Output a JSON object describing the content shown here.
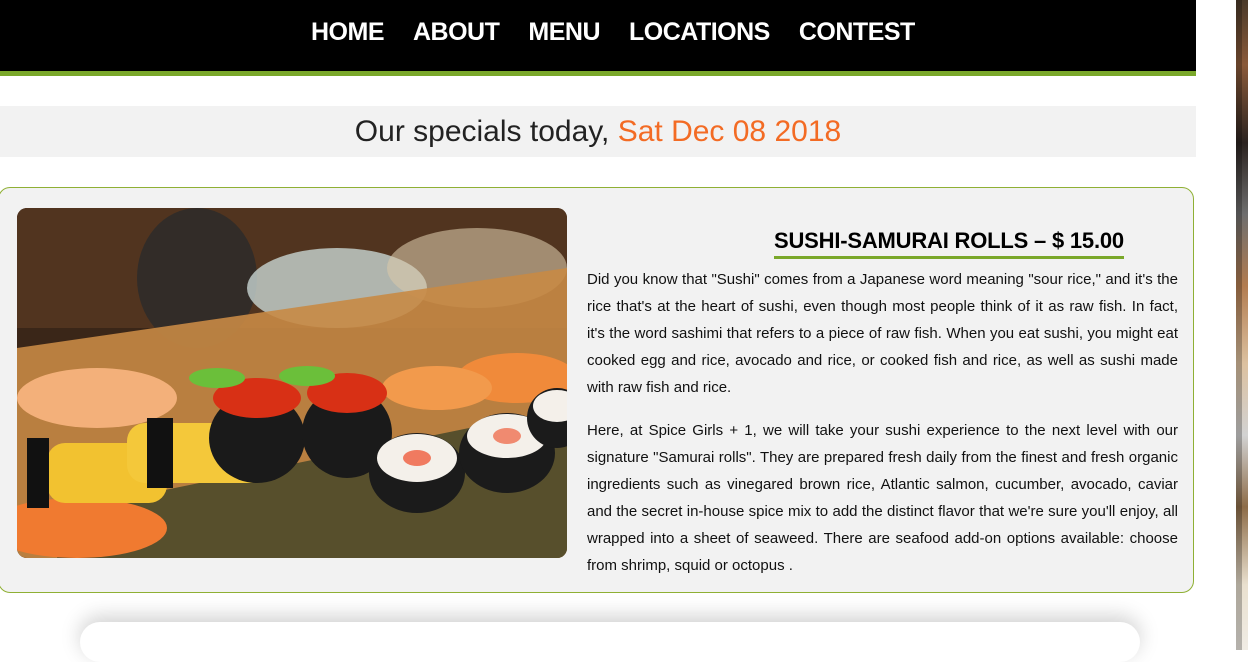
{
  "nav": {
    "items": [
      "HOME",
      "ABOUT",
      "MENU",
      "LOCATIONS",
      "CONTEST"
    ]
  },
  "specials": {
    "prefix": "Our specials today, ",
    "date": "Sat Dec 08 2018"
  },
  "dish": {
    "title": "SUSHI-SAMURAI ROLLS – $ 15.00",
    "paragraphs": [
      "Did you know that \"Sushi\" comes from a Japanese word meaning \"sour rice,\" and it's the rice that's at the heart of sushi, even though most people think of it as raw fish. In fact, it's the word sashimi that refers to a piece of raw fish. When you eat sushi, you might eat cooked egg and rice, avocado and rice, or cooked fish and rice, as well as sushi made with raw fish and rice.",
      "Here, at Spice Girls + 1, we will take your sushi experience to the next level with our signature \"Samurai rolls\". They are prepared fresh daily from the finest and fresh organic ingredients such as vinegared brown rice, Atlantic salmon, cucumber, avocado, caviar and the secret in-house spice mix to add the distinct flavor that we're sure you'll enjoy, all wrapped into a sheet of seaweed. There are seafood add-on options available: choose from shrimp, squid or octopus ."
    ]
  },
  "colors": {
    "accent_green": "#7aa82a",
    "accent_orange": "#f36b24",
    "nav_bg": "#000000"
  }
}
